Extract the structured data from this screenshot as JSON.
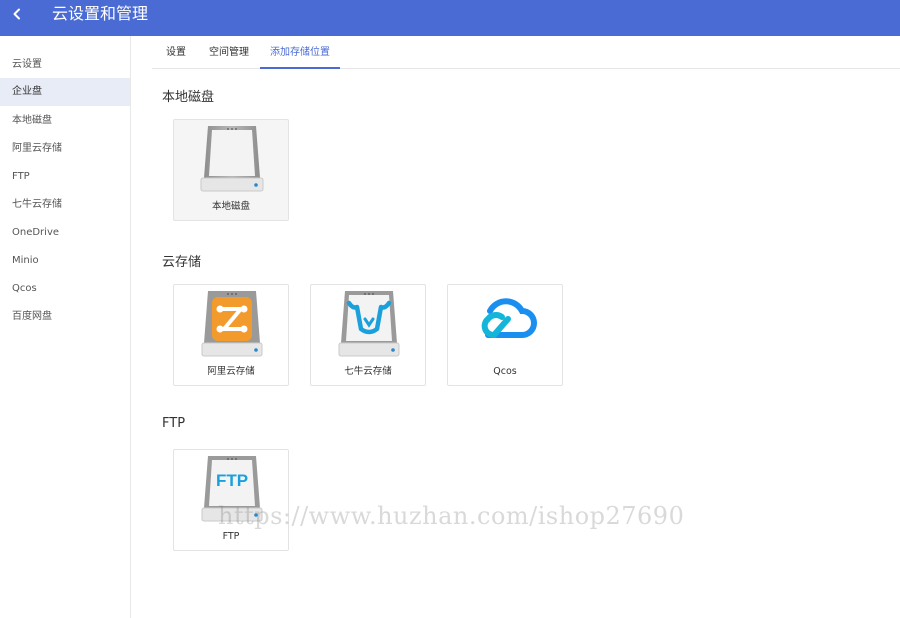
{
  "header": {
    "title": "云设置和管理",
    "back_icon": "chevron-left-icon"
  },
  "sidebar": {
    "items": [
      {
        "label": "云设置"
      },
      {
        "label": "企业盘"
      },
      {
        "label": "本地磁盘"
      },
      {
        "label": "阿里云存储"
      },
      {
        "label": "FTP"
      },
      {
        "label": "七牛云存储"
      },
      {
        "label": "OneDrive"
      },
      {
        "label": "Minio"
      },
      {
        "label": "Qcos"
      },
      {
        "label": "百度网盘"
      }
    ],
    "active_item": "企业盘"
  },
  "tabs": [
    {
      "label": "设置"
    },
    {
      "label": "空间管理"
    },
    {
      "label": "添加存储位置"
    }
  ],
  "active_tab": "添加存储位置",
  "sections": {
    "local": {
      "title": "本地磁盘",
      "cards": [
        {
          "label": "本地磁盘",
          "icon": "hard-drive-icon"
        }
      ]
    },
    "cloud": {
      "title": "云存储",
      "cards": [
        {
          "label": "阿里云存储",
          "icon": "aliyun-drive-icon"
        },
        {
          "label": "七牛云存储",
          "icon": "qiniu-drive-icon"
        },
        {
          "label": "Qcos",
          "icon": "tencent-cloud-icon"
        }
      ]
    },
    "ftp": {
      "title": "FTP",
      "cards": [
        {
          "label": "FTP",
          "icon": "ftp-drive-icon",
          "icon_text": "FTP"
        }
      ]
    }
  },
  "watermark": "https://www.huzhan.com/ishop27690",
  "colors": {
    "header": "#4a6bd3",
    "accent": "#4a6bd3",
    "aliyun": "#f39a2c",
    "qiniu": "#1ca0dc",
    "qcos": "#1a8ff0"
  }
}
